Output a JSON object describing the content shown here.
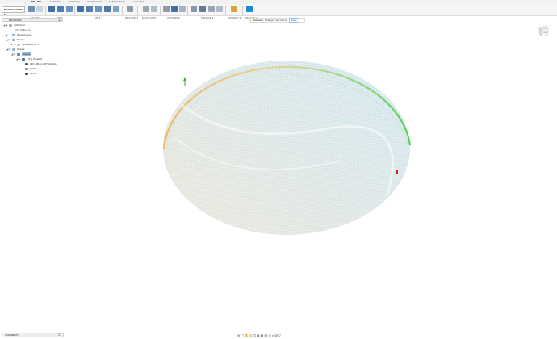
{
  "tabs": [
    "MILLING",
    "TURNING",
    "ADDITIVE",
    "INSPECTION",
    "FABRICATION",
    "UTILITIES"
  ],
  "workspace": "MANUFACTURE",
  "toolbar_groups": [
    "SETUP",
    "2D",
    "3D",
    "DRILLING",
    "MULTI-AXIS",
    "ACTIONS",
    "MANAGE",
    "INSPECT",
    "SELECT"
  ],
  "notification": {
    "label": "Unsaved:",
    "message": "Changes may be lost",
    "action": "Save"
  },
  "browser": {
    "header": "BROWSER",
    "items": [
      {
        "label": "CAM Root",
        "indent": 0
      },
      {
        "label": "Units: mm",
        "indent": 1
      },
      {
        "label": "Named Views",
        "indent": 1
      },
      {
        "label": "Models",
        "indent": 1
      },
      {
        "label": "(Unsaved) v1",
        "indent": 2
      },
      {
        "label": "Setups",
        "indent": 1
      },
      {
        "label": "Setup1",
        "indent": 2
      },
      {
        "label": "[T2] Parallel1",
        "indent": 3
      },
      {
        "label": "#20 - Ø1mm 45° chamfer",
        "indent": 4
      },
      {
        "label": "WCS",
        "indent": 4
      },
      {
        "label": "34 dfs",
        "indent": 4
      }
    ]
  },
  "comments": "COMMENTS",
  "viewcube_label": "FRONT",
  "colors": {
    "accent": "#0a84ff",
    "toolpath_blue": "#3b88d4",
    "toolpath_green": "#44cc33",
    "toolpath_orange": "#e89a2a"
  }
}
